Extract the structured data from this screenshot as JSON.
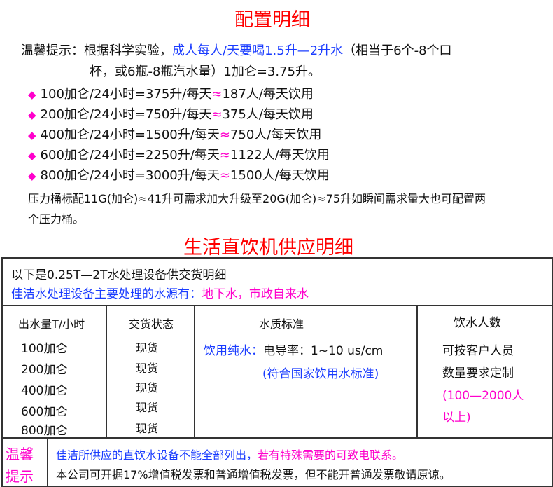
{
  "title": "配置明细",
  "tip": {
    "label": "温馨提示：",
    "text1": "根据科学实验，",
    "highlight": "成人每人/天要喝1.5升—2升水",
    "text2": "（相当于6个-8个口",
    "line2": "杯，或6瓶-8瓶汽水量）1加仑=3.75升。"
  },
  "bullets": [
    {
      "left": "100加仑/24小时=375升/每天",
      "approx": "≈",
      "right": "187人/每天饮用"
    },
    {
      "left": "200加仑/24小时=750升/每天",
      "approx": "≈",
      "right": "375人/每天饮用"
    },
    {
      "left": "400加仑/24小时=1500升/每天",
      "approx": "≈",
      "right": "750人/每天饮用"
    },
    {
      "left": "600加仑/24小时=2250升/每天",
      "approx": "≈",
      "right": "1122人/每天饮用"
    },
    {
      "left": "800加仑/24小时=3000升/每天",
      "approx": "≈",
      "right": "1500人/每天饮用"
    }
  ],
  "bullet_symbol": "◆",
  "pressure_note": {
    "line1": "压力桶标配11G(加仑)≈41升可需求加大升级至20G(加仑)≈75升如瞬间需求量大也可配置两",
    "line2": "个压力桶。"
  },
  "supply_title": "生活直饮机供应明细",
  "table": {
    "intro": "以下是0.25T—2T水处理设备供交货明细",
    "source_label": "佳洁水处理设备主要处理的水源有：",
    "source_value": "地下水，市政自来水",
    "headers": {
      "output": "出水量T/小时",
      "delivery": "交货状态",
      "quality": "水质标准",
      "people": "饮水人数"
    },
    "outputs": [
      "100加仑",
      "200加仑",
      "400加仑",
      "600加仑",
      "800加仑"
    ],
    "deliveries": [
      "现货",
      "现货",
      "现货",
      "现货",
      "现货"
    ],
    "quality": {
      "type": "饮用纯水：",
      "conductivity": "电导率：1~10 us/cm",
      "standard": "(符合国家饮用水标准)"
    },
    "people": {
      "line1": "可按客户人员",
      "line2": "数量要求定制",
      "range1": "(100—2000人",
      "range2": "以上)"
    },
    "footer": {
      "label1": "温馨",
      "label2": "提示",
      "note_blue": "佳洁所供应的直饮水设备不能全部列出，",
      "note_magenta": "若有特殊需要的可致电联系。",
      "invoice": "本公司可开据17%增值税发票和普通增值税发票，但不能开普通发票敬请原谅。"
    }
  },
  "colors": {
    "red": "#ff0000",
    "blue": "#1a3cff",
    "magenta": "#ff00cc"
  }
}
